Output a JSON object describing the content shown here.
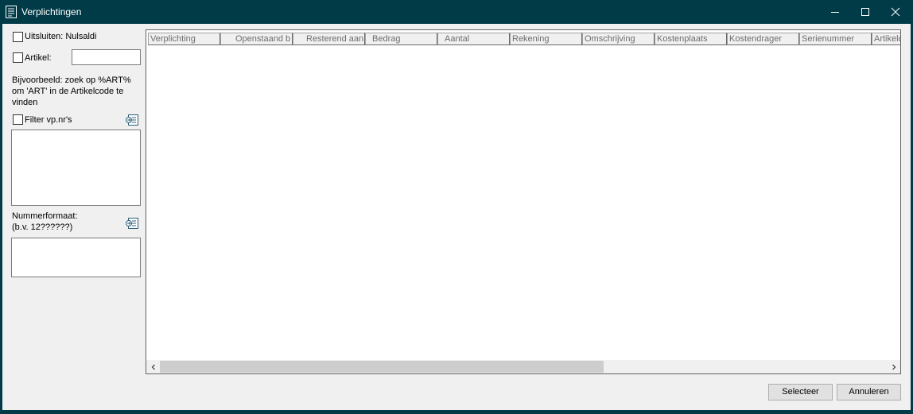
{
  "window": {
    "title": "Verplichtingen",
    "icon": "list-document-icon"
  },
  "filters": {
    "exclude_zero_label": "Uitsluiten: Nulsaldi",
    "exclude_zero_checked": false,
    "article_label": "Artikel:",
    "article_checked": false,
    "article_value": "",
    "hint_line1": "Bijvoorbeeld: zoek op %ART%",
    "hint_line2": "om 'ART' in de Artikelcode te",
    "hint_line3": "vinden",
    "filter_vpnr_label": "Filter vp.nr's",
    "filter_vpnr_checked": false,
    "filter_vpnr_list": "",
    "number_format_label1": "Nummerformaat:",
    "number_format_label2": "(b.v. 12??????)",
    "number_format_value": ""
  },
  "grid": {
    "columns": [
      "Verplichting",
      "Openstaand b",
      "Resterend aan",
      "Bedrag",
      "Aantal",
      "Rekening",
      "Omschrijving",
      "Kostenplaats",
      "Kostendrager",
      "Serienummer",
      "Artikelc"
    ],
    "rows": []
  },
  "buttons": {
    "select_label": "Selecteer",
    "cancel_label": "Annuleren"
  },
  "colors": {
    "frame": "#013b48",
    "client": "#f0f0f0",
    "grid_bg": "#ffffff"
  }
}
